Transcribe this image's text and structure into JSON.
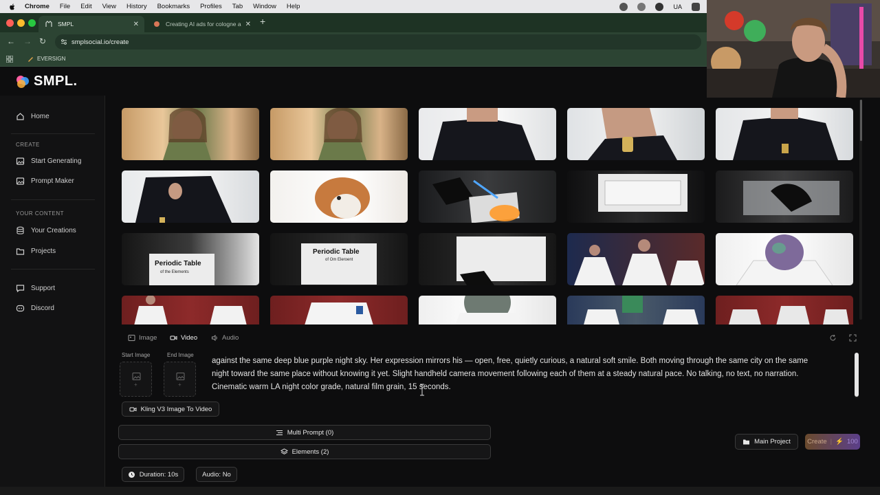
{
  "menubar": {
    "app": "Chrome",
    "items": [
      "File",
      "Edit",
      "View",
      "History",
      "Bookmarks",
      "Profiles",
      "Tab",
      "Window",
      "Help"
    ],
    "input_source": "UA"
  },
  "browser": {
    "tabs": [
      {
        "title": "SMPL",
        "active": true
      },
      {
        "title": "Creating AI ads for cologne a",
        "active": false
      }
    ],
    "url": "smplsocial.io/create",
    "bookmark": "EVERSIGN"
  },
  "app": {
    "logo": "SMPL.",
    "sidebar": {
      "home": "Home",
      "create_section": "CREATE",
      "start_generating": "Start Generating",
      "prompt_maker": "Prompt Maker",
      "content_section": "YOUR CONTENT",
      "your_creations": "Your Creations",
      "projects": "Projects",
      "support": "Support",
      "discord": "Discord"
    },
    "gallery": {
      "rows": 4,
      "columns": 5,
      "thumbs": [
        "woman-bedroom",
        "woman-bedroom",
        "man-black-shirt",
        "man-spraying-cologne",
        "man-seated",
        "man-adjusting-shirt",
        "corgi-dog",
        "periodic-table-blowtorch",
        "periodic-table-box",
        "gloved-hands-glass",
        "periodic-table-held",
        "periodic-table-held",
        "periodic-table-held",
        "doctors-seated",
        "glitter-head-lab-coat",
        "doctors-group",
        "lab-coat",
        "glitter-head",
        "lab-coat-group",
        "doctors-seated"
      ],
      "visible_text": [
        "Periodic Table",
        "of the Elements",
        "Periodic Table",
        "of Om Eleroent"
      ]
    },
    "composer": {
      "mode_tabs": [
        "Image",
        "Video",
        "Audio"
      ],
      "active_mode": "Video",
      "start_image_label": "Start Image",
      "end_image_label": "End Image",
      "prompt_lines": [
        "against the same deep blue purple night sky. Her expression mirrors his — open, free, quietly curious, a natural soft smile. Both moving through the same city on the same",
        "night toward the same place without knowing it yet. Slight handheld camera movement following each of them at a steady natural pace. No talking, no text, no narration.",
        "Cinematic warm LA night color grade, natural film grain, 15 seconds."
      ],
      "model": "Kling V3 Image To Video",
      "multi_prompt": "Multi Prompt (0)",
      "elements": "Elements (2)",
      "duration": "Duration: 10s",
      "audio": "Audio: No",
      "project": "Main Project",
      "create_label": "Create",
      "create_cost": "100"
    }
  },
  "colors": {
    "tabbar": "#1e3324",
    "addrbar": "#2c4433",
    "app_bg": "#0d0d0e",
    "create_gradient_start": "#6a4a2d",
    "create_gradient_end": "#5b3f8a"
  }
}
